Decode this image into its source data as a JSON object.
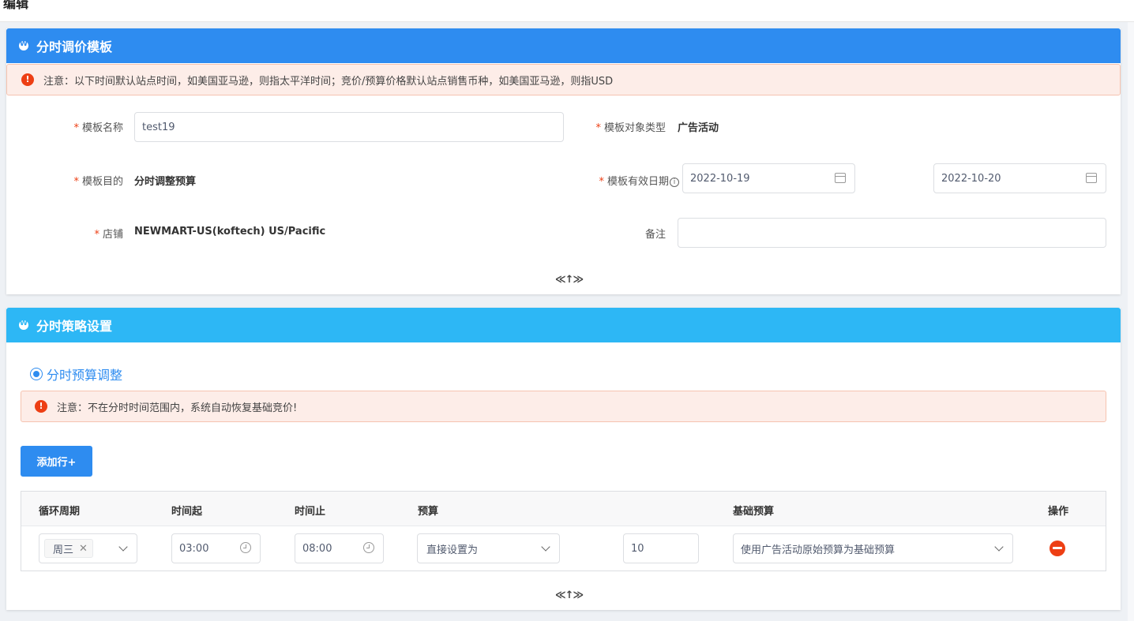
{
  "topbar": {
    "title": "编辑"
  },
  "template_panel": {
    "title": "分时调价模板",
    "notice": "注意：以下时间默认站点时间，如美国亚马逊，则指太平洋时间；竞价/预算价格默认站点销售币种，如美国亚马逊，则指USD",
    "fields": {
      "name_label": "模板名称",
      "name_value": "test19",
      "object_type_label": "模板对象类型",
      "object_type_value": "广告活动",
      "purpose_label": "模板目的",
      "purpose_value": "分时调整预算",
      "valid_date_label": "模板有效日期",
      "start_date": "2022-10-19",
      "end_date": "2022-10-20",
      "shop_label": "店铺",
      "shop_value": "NEWMART-US(koftech) US/Pacific",
      "remark_label": "备注",
      "remark_value": ""
    },
    "collapse_icon": "≪↑≫"
  },
  "strategy_panel": {
    "title": "分时策略设置",
    "radio_label": "分时预算调整",
    "notice": "注意：不在分时时间范围内，系统自动恢复基础竞价!",
    "add_row_label": "添加行+",
    "table": {
      "headers": [
        "循环周期",
        "时间起",
        "时间止",
        "预算",
        "基础预算",
        "操作"
      ],
      "rows": [
        {
          "cycle_tag": "周三",
          "start_time": "03:00",
          "end_time": "08:00",
          "budget_mode": "直接设置为",
          "budget_value": "10",
          "base_budget": "使用广告活动原始预算为基础预算"
        }
      ]
    },
    "collapse_icon": "≪↑≫"
  },
  "colors": {
    "primary": "#2e8cf0",
    "info": "#2db7f5",
    "error": "#ed3f14",
    "notice_bg": "#fdede8"
  }
}
